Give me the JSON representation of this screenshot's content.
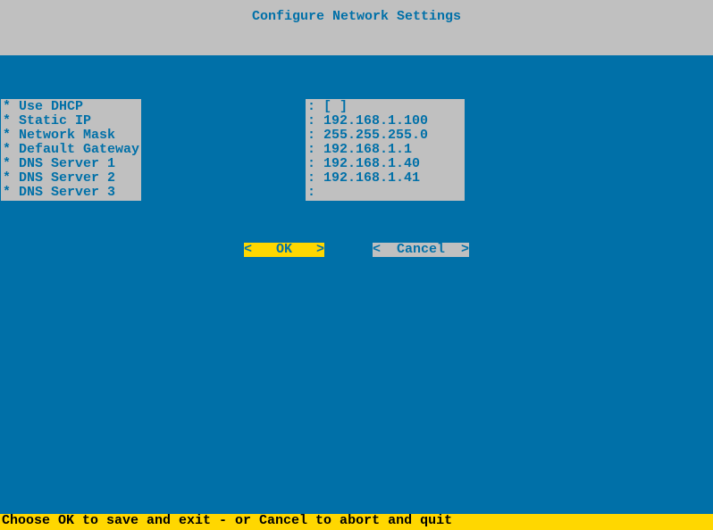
{
  "title": "Configure Network Settings",
  "fields": [
    {
      "label": "Use DHCP",
      "value": "[ ]"
    },
    {
      "label": "Static IP",
      "value": "192.168.1.100"
    },
    {
      "label": "Network Mask",
      "value": "255.255.255.0"
    },
    {
      "label": "Default Gateway",
      "value": "192.168.1.1"
    },
    {
      "label": "DNS Server 1",
      "value": "192.168.1.40"
    },
    {
      "label": "DNS Server 2",
      "value": "192.168.1.41"
    },
    {
      "label": "DNS Server 3",
      "value": ""
    }
  ],
  "buttons": {
    "ok": "<   OK   >",
    "cancel": "<  Cancel  >"
  },
  "footer": "Choose OK to save and exit - or Cancel to abort and quit"
}
